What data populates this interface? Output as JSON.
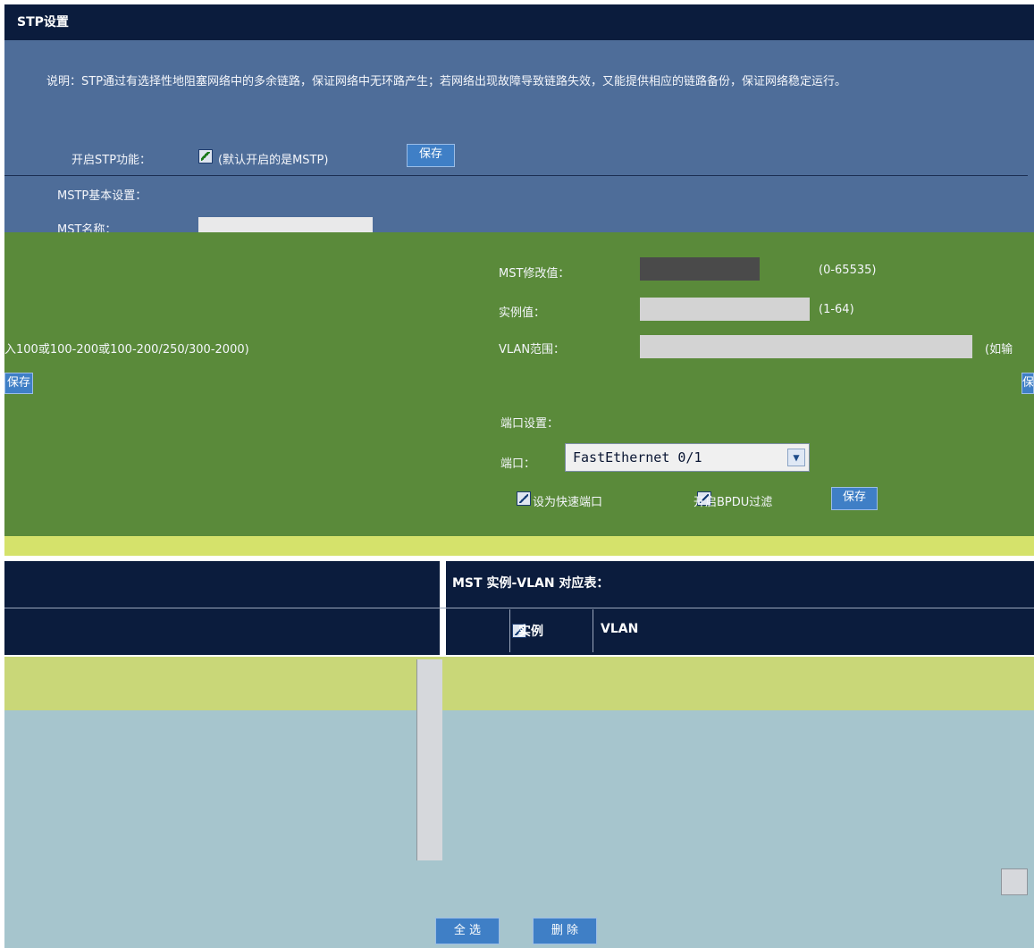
{
  "page": {
    "title": "STP设置",
    "description": "说明：STP通过有选择性地阻塞网络中的多余链路，保证网络中无环路产生；若网络出现故障导致链路失效，又能提供相应的链路备份，保证网络稳定运行。",
    "enable_label": "开启STP功能：",
    "enable_note": "(默认开启的是MSTP)",
    "enable_checked": true,
    "enable_save": "保存"
  },
  "mstp": {
    "section_label": "MSTP基本设置：",
    "name_label": "MST名称：",
    "name_value": "",
    "revision_label": "MST修改值：",
    "revision_value": "",
    "revision_range": "(0-65535)",
    "instance_label": "实例值：",
    "instance_value": "",
    "instance_range": "(1-64)",
    "vlan_label": "VLAN范围：",
    "vlan_value": "",
    "vlan_hint_right": "(如输",
    "vlan_hint_left": "入100或100-200或100-200/250/300-2000)",
    "save_left": "保存",
    "save_right": "保"
  },
  "port": {
    "section_label": "端口设置：",
    "port_label": "端口：",
    "port_value": "FastEthernet 0/1",
    "fast_port_label": "设为快速端口",
    "fast_port_checked": false,
    "bpdu_label": "开启BPDU过滤",
    "bpdu_checked": false,
    "save": "保存"
  },
  "table": {
    "title": "MST 实例-VLAN 对应表：",
    "columns": [
      "实例",
      "VLAN"
    ],
    "rows": []
  },
  "actions": {
    "select_all": "全 选",
    "delete": "删 除"
  },
  "colors": {
    "title_bg": "#0b1c3d",
    "panel_bg": "#4e6d99",
    "button_bg": "#3f7fc6"
  }
}
